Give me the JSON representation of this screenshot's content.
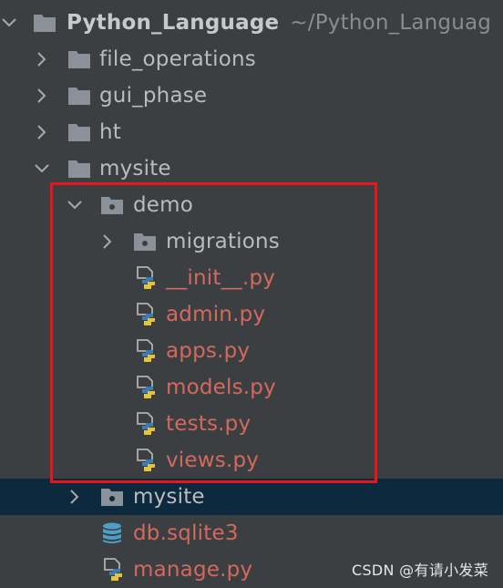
{
  "tree": {
    "root": {
      "name": "Python_Language",
      "path": "~/Python_Languag"
    },
    "file_operations": "file_operations",
    "gui_phase": "gui_phase",
    "ht": "ht",
    "mysite": "mysite",
    "demo": "demo",
    "migrations": "migrations",
    "demo_files": [
      "__init__.py",
      "admin.py",
      "apps.py",
      "models.py",
      "tests.py",
      "views.py"
    ],
    "inner_mysite": "mysite",
    "db": "db.sqlite3",
    "manage": "manage.py"
  },
  "watermark": "CSDN @有请小发菜",
  "colors": {
    "background": "#3c3f41",
    "text": "#bbbbbb",
    "modified_file": "#d3695d",
    "selected_row": "#0d293e",
    "highlight_border": "#e8151a",
    "folder_icon": "#8a9199",
    "db_icon": "#4e9ec7"
  }
}
